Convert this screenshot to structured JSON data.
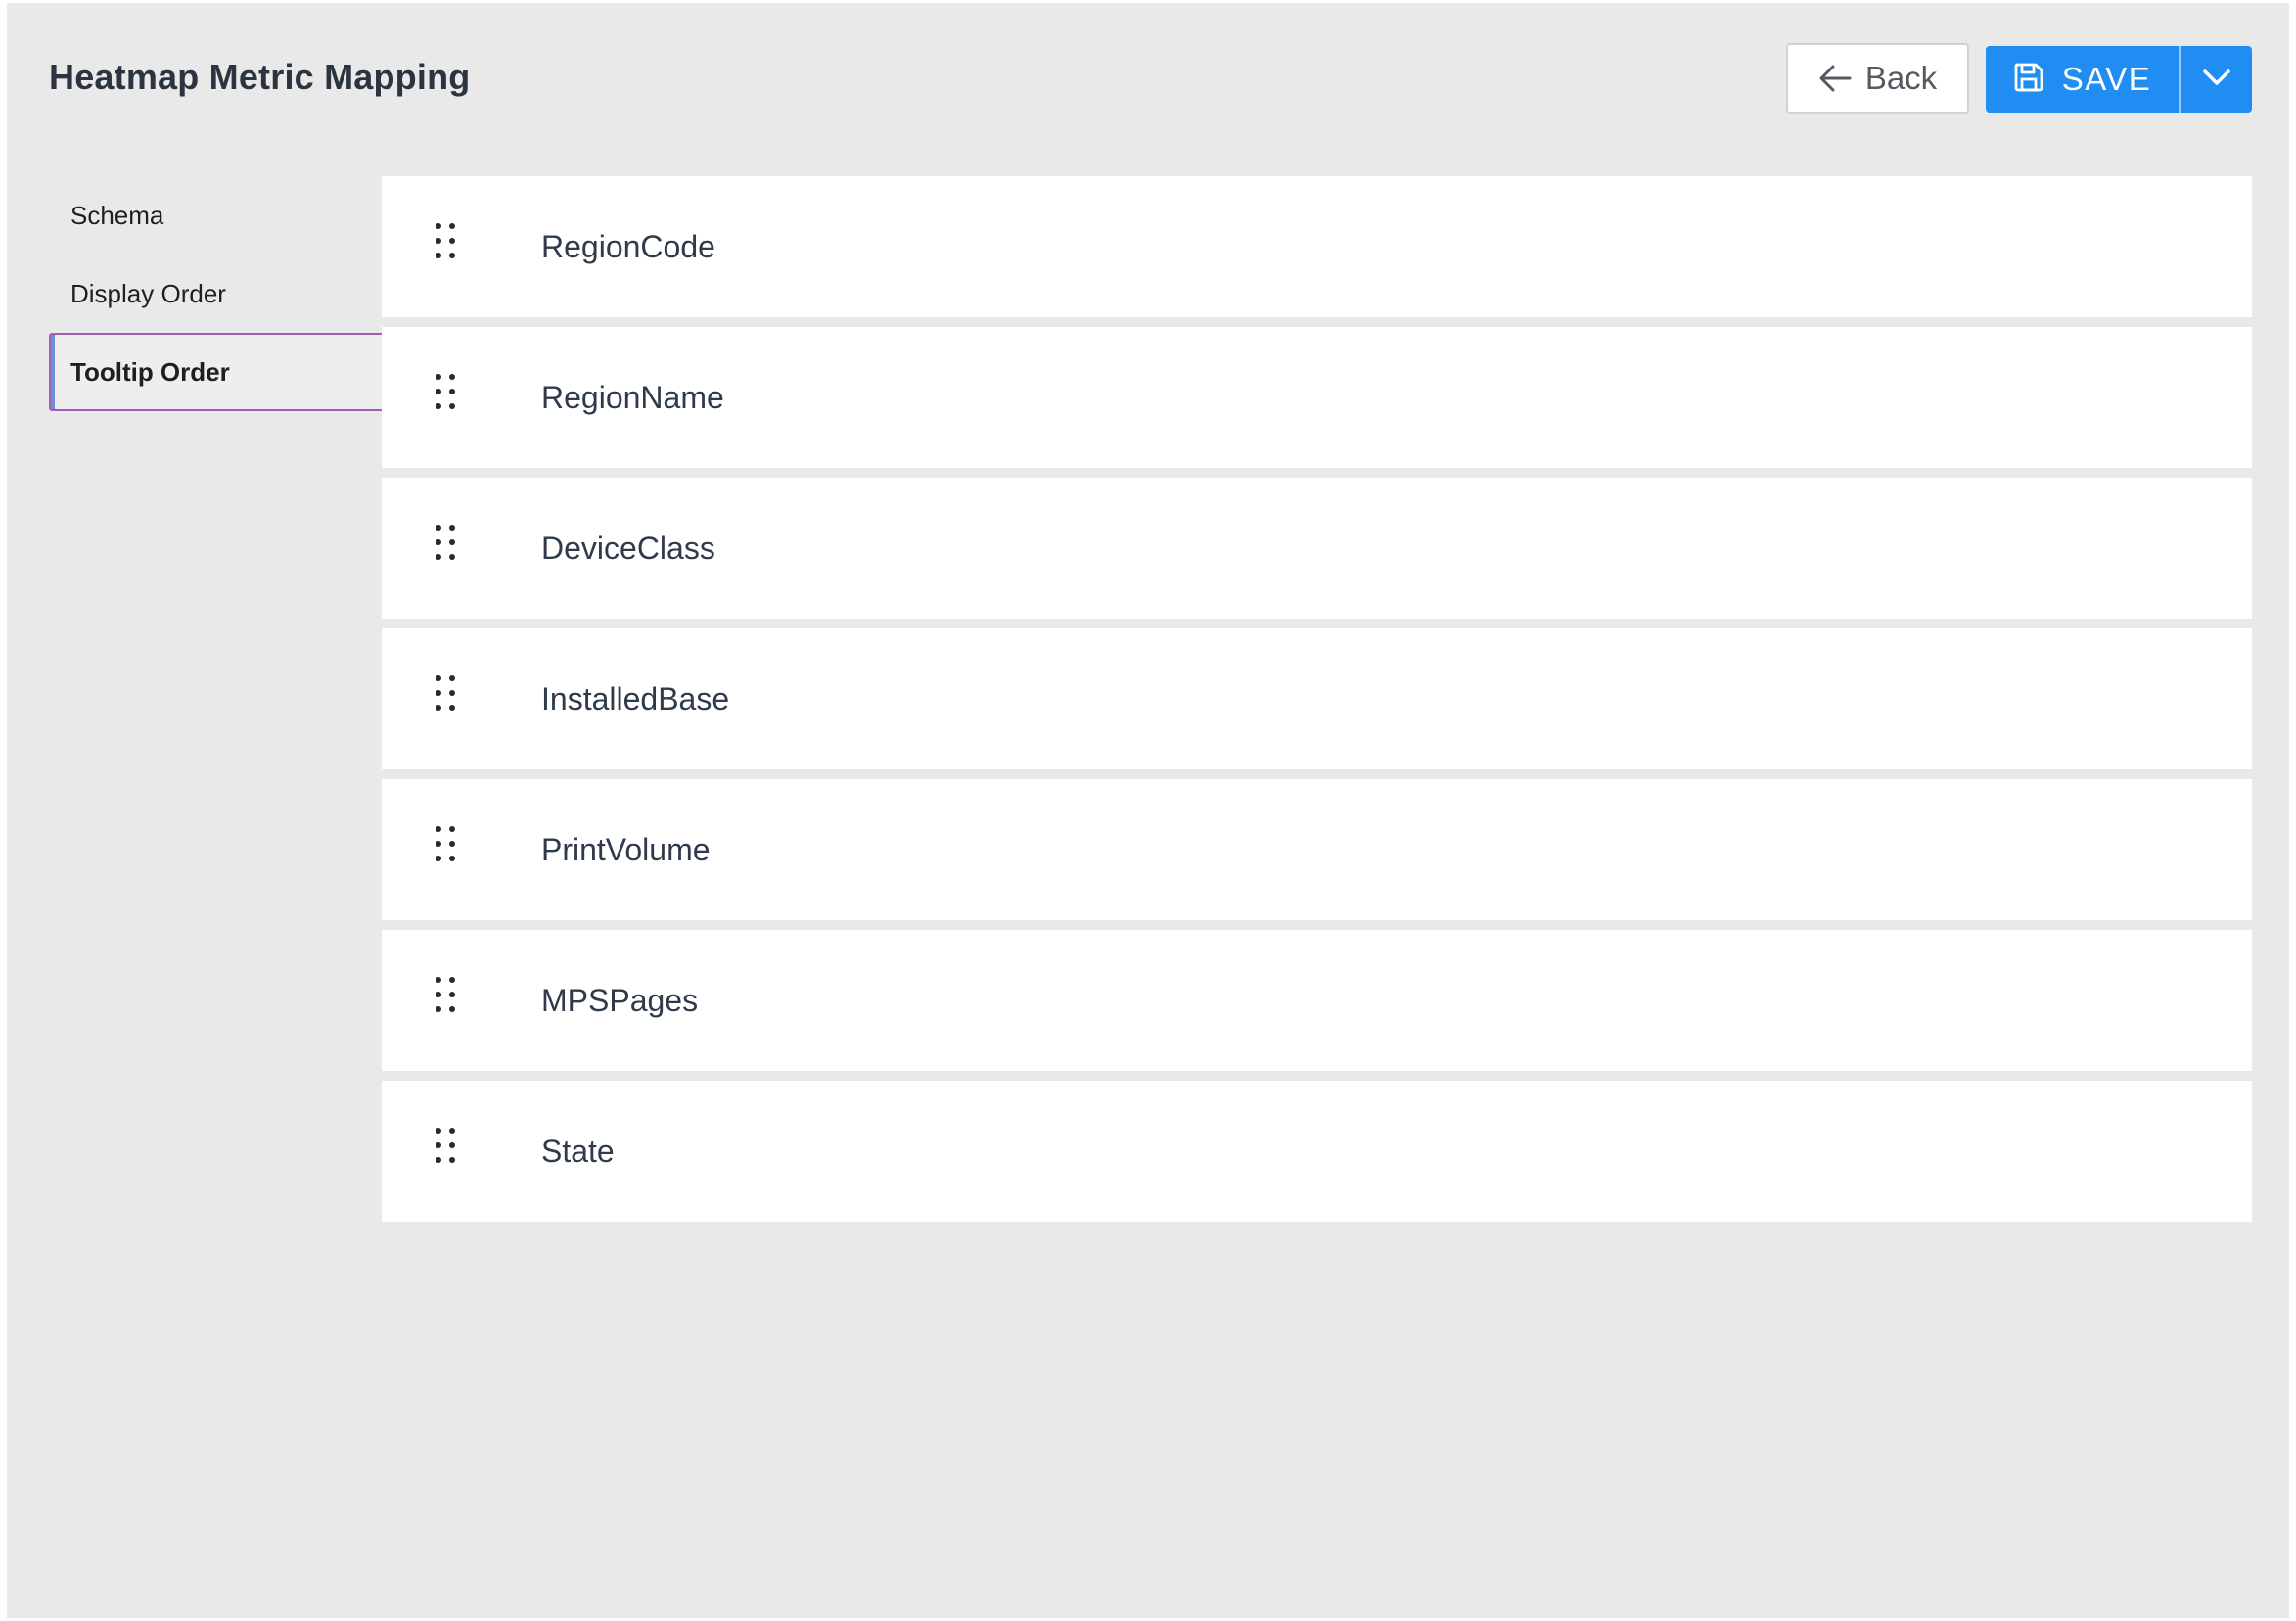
{
  "header": {
    "title": "Heatmap Metric Mapping",
    "back_label": "Back",
    "save_label": "SAVE"
  },
  "sidebar": {
    "items": [
      {
        "label": "Schema",
        "active": false
      },
      {
        "label": "Display Order",
        "active": false
      },
      {
        "label": "Tooltip Order",
        "active": true
      }
    ]
  },
  "fields": [
    {
      "label": "RegionCode"
    },
    {
      "label": "RegionName"
    },
    {
      "label": "DeviceClass"
    },
    {
      "label": "InstalledBase"
    },
    {
      "label": "PrintVolume"
    },
    {
      "label": "MPSPages"
    },
    {
      "label": "State"
    }
  ],
  "icons": {
    "back": "arrow-left-icon",
    "save": "floppy-disk-icon",
    "dropdown": "chevron-down-icon",
    "drag": "drag-handle-icon"
  },
  "colors": {
    "accent": "#1f8df2",
    "active_border": "#a45fb5",
    "background": "#e9e9e9",
    "title_text": "#2c3440"
  }
}
